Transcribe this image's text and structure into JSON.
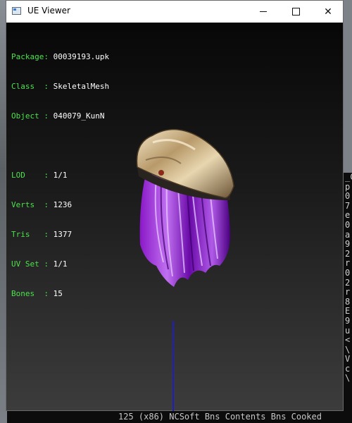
{
  "window": {
    "title": "UE Viewer",
    "controls": {
      "minimize": "—",
      "maximize": "☐",
      "close": "✕"
    }
  },
  "info": {
    "package_label": "Package:",
    "package": "00039193.upk",
    "class_label": "Class  :",
    "class": "SkeletalMesh",
    "object_label": "Object :",
    "object": "040079_KunN",
    "lod_label": "LOD    :",
    "lod": "1/1",
    "verts_label": "Verts  :",
    "verts": "1236",
    "tris_label": "Tris   :",
    "tris": "1377",
    "uvset_label": "UV Set :",
    "uvset": "1/1",
    "bones_label": "Bones  :",
    "bones": "15"
  },
  "background_terminal": {
    "right_lines": [
      "_C",
      "p",
      "0",
      "7",
      "e",
      "0",
      "a",
      "9",
      "2",
      "r",
      "0",
      "2",
      "r",
      "8",
      "E",
      "9",
      "u",
      "<",
      "\\",
      "V",
      "c",
      "\\"
    ],
    "bottom_line": "125 (x86) NCSoft Bns Contents Bns Cooked"
  },
  "colors": {
    "label_green": "#4ee04e",
    "value_white": "#ffffff",
    "axis_blue": "#1f1fbf"
  }
}
